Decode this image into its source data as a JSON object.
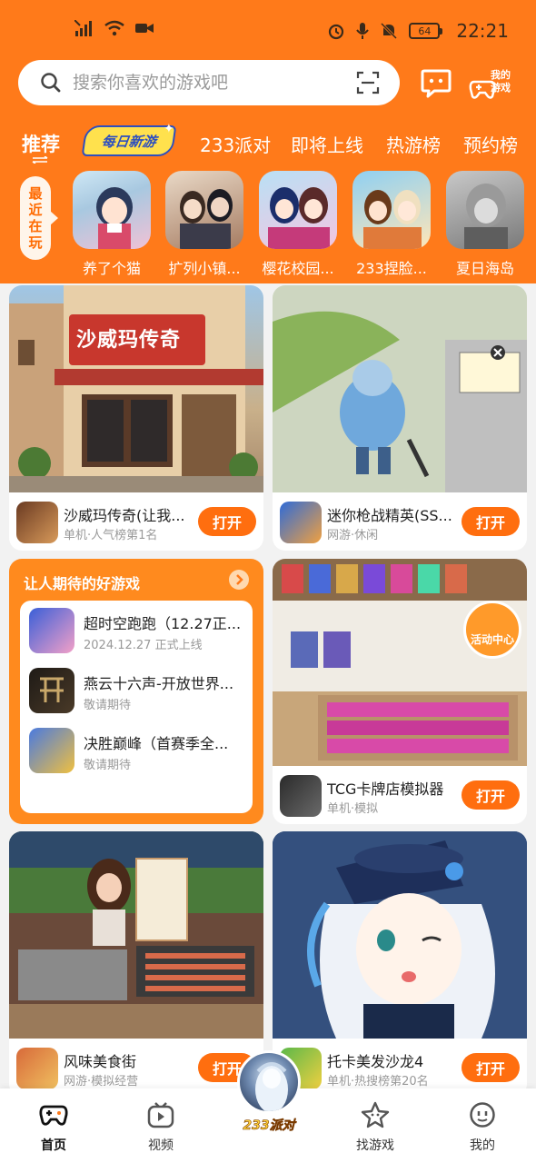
{
  "status_bar": {
    "time": "22:21",
    "battery": "64"
  },
  "search": {
    "placeholder": "搜索你喜欢的游戏吧"
  },
  "header": {
    "my_games_label": "我的游戏"
  },
  "tabs": [
    {
      "label": "推荐"
    },
    {
      "label": "每日新游"
    },
    {
      "label": "233派对"
    },
    {
      "label": "即将上线"
    },
    {
      "label": "热游榜"
    },
    {
      "label": "预约榜"
    }
  ],
  "recent": {
    "label": "最近在玩",
    "items": [
      {
        "name": "养了个猫"
      },
      {
        "name": "扩列小镇..."
      },
      {
        "name": "樱花校园..."
      },
      {
        "name": "233捏脸..."
      },
      {
        "name": "夏日海岛"
      }
    ]
  },
  "cards": [
    {
      "title": "沙威玛传奇(让我...",
      "sub": "单机·人气榜第1名",
      "button": "打开",
      "banner_text": "沙威玛传奇"
    },
    {
      "title": "迷你枪战精英(SS...",
      "sub": "网游·休闲",
      "button": "打开"
    },
    {
      "title": "TCG卡牌店模拟器",
      "sub": "单机·模拟",
      "button": "打开",
      "badge": "活动中心"
    },
    {
      "title": "风味美食街",
      "sub": "网游·模拟经营",
      "button": "打开"
    },
    {
      "title": "托卡美发沙龙4",
      "sub": "单机·热搜榜第20名",
      "button": "打开"
    }
  ],
  "anticipated": {
    "title": "让人期待的好游戏",
    "items": [
      {
        "title": "超时空跑跑（12.27正...",
        "sub": "2024.12.27 正式上线"
      },
      {
        "title": "燕云十六声-开放世界...",
        "sub": "敬请期待"
      },
      {
        "title": "决胜巅峰（首赛季全...",
        "sub": "敬请期待"
      }
    ]
  },
  "bottom_nav": [
    {
      "label": "首页"
    },
    {
      "label": "视频"
    },
    {
      "label": "233派对"
    },
    {
      "label": "找游戏"
    },
    {
      "label": "我的"
    }
  ],
  "colors": {
    "brand": "#ff7a1a",
    "button": "#ff6e0f"
  }
}
